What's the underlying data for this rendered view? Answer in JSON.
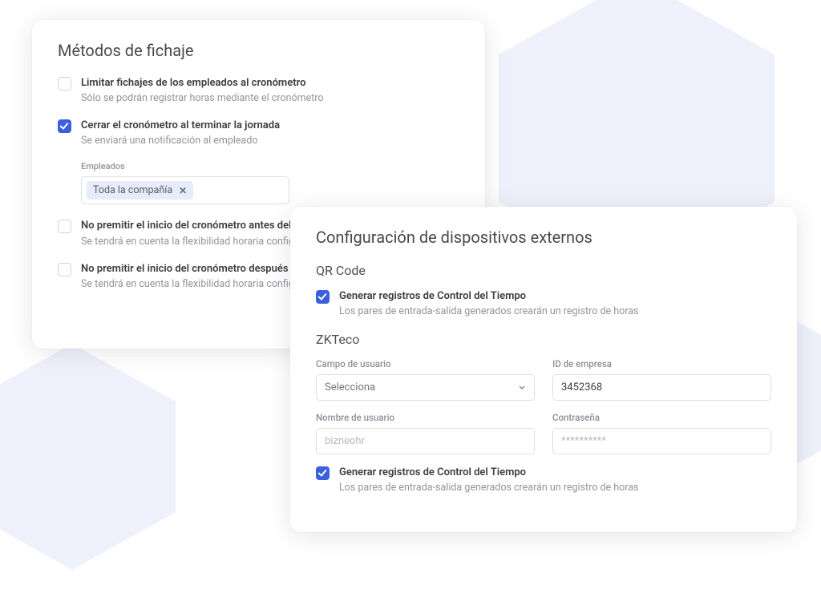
{
  "card1": {
    "title": "Métodos de fichaje",
    "opt1": {
      "label": "Limitar fichajes de los empleados al cronómetro",
      "desc": "Sólo se podrán registrar horas mediante el cronómetro"
    },
    "opt2": {
      "label": "Cerrar el cronómetro al terminar la jornada",
      "desc": "Se enviará una notificación al empleado"
    },
    "employees_label": "Empleados",
    "employees_tag": "Toda la compañía",
    "opt3": {
      "label": "No premitir el inicio del cronómetro antes del horario de inicio",
      "desc": "Se tendrá en cuenta la flexibilidad horaria configurada"
    },
    "opt4": {
      "label": "No premitir el inicio del cronómetro después del horario de finalización",
      "desc": "Se tendrá en cuenta la flexibilidad horaria configurada"
    }
  },
  "card2": {
    "title": "Configuración de dispositivos externos",
    "qr_section": "QR Code",
    "qr_opt": {
      "label": "Generar registros de Control del Tiempo",
      "desc": "Los pares de entrada-salida generados crearán un registro de horas"
    },
    "zk_section": "ZKTeco",
    "user_field_label": "Campo de usuario",
    "user_field_placeholder": "Selecciona",
    "company_id_label": "ID de empresa",
    "company_id_value": "3452368",
    "username_label": "Nombre de usuario",
    "username_placeholder": "bizneohr",
    "password_label": "Contraseña",
    "password_placeholder": "**********",
    "zk_opt": {
      "label": "Generar registros de Control del Tiempo",
      "desc": "Los pares de entrada-salida generados crearán un registro de horas"
    }
  }
}
